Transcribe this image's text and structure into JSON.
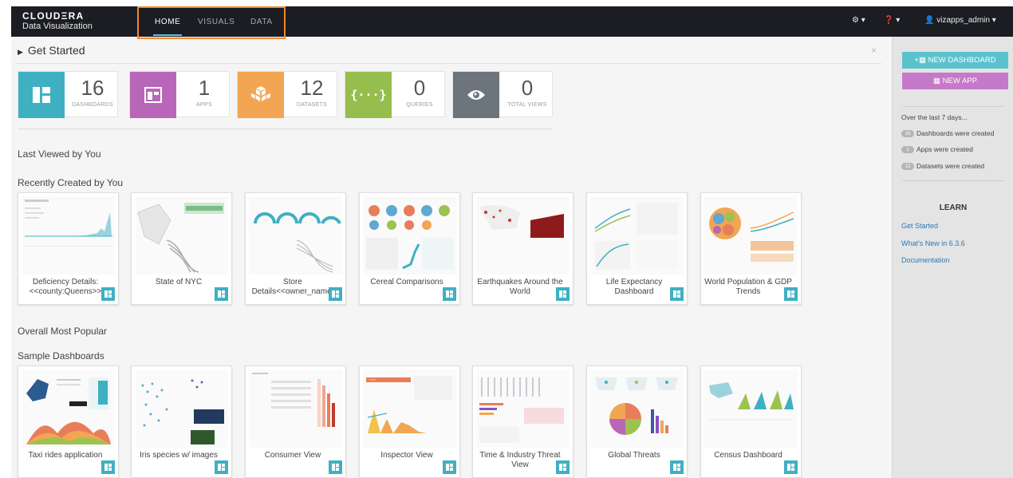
{
  "brand": {
    "line1": "CLOUDΞRA",
    "line2": "Data Visualization"
  },
  "nav": {
    "home": "HOME",
    "visuals": "VISUALS",
    "data": "DATA"
  },
  "topright": {
    "settings": "⚙ ▾",
    "help": "❓ ▾",
    "user": "👤 vizapps_admin ▾"
  },
  "get_started": {
    "title": "Get Started",
    "close": "×"
  },
  "stats": [
    {
      "num": "16",
      "label": "DASHBOARDS",
      "color": "#3fb0c2"
    },
    {
      "num": "1",
      "label": "APPS",
      "color": "#b866b8"
    },
    {
      "num": "12",
      "label": "DATASETS",
      "color": "#f2a552"
    },
    {
      "num": "0",
      "label": "QUERIES",
      "color": "#95be4d"
    },
    {
      "num": "0",
      "label": "TOTAL VIEWS",
      "color": "#6c757c"
    }
  ],
  "sections": {
    "last_viewed": "Last Viewed by You",
    "recently_created": "Recently Created by You",
    "most_popular": "Overall Most Popular",
    "sample": "Sample Dashboards"
  },
  "recent_cards": [
    "Deficiency Details: <<county:Queens>>",
    "State of NYC",
    "Store Details<<owner_name:",
    "Cereal Comparisons",
    "Earthquakes Around the World",
    "Life Expectancy Dashboard",
    "World Population & GDP Trends"
  ],
  "sample_cards": [
    "Taxi rides application",
    "Iris species w/ images",
    "Consumer View",
    "Inspector View",
    "Time & Industry Threat View",
    "Global Threats",
    "Census Dashboard"
  ],
  "sidebar": {
    "new_dashboard": "+▦ NEW DASHBOARD",
    "new_app": "▦ NEW APP",
    "over_last": "Over the last 7 days...",
    "dash_count": "16",
    "dash_text": "Dashboards were created",
    "app_count": "1",
    "app_text": "Apps were created",
    "ds_count": "12",
    "ds_text": "Datasets were created",
    "learn": "LEARN",
    "links": [
      "Get Started",
      "What's New in 6.3.6",
      "Documentation"
    ]
  }
}
